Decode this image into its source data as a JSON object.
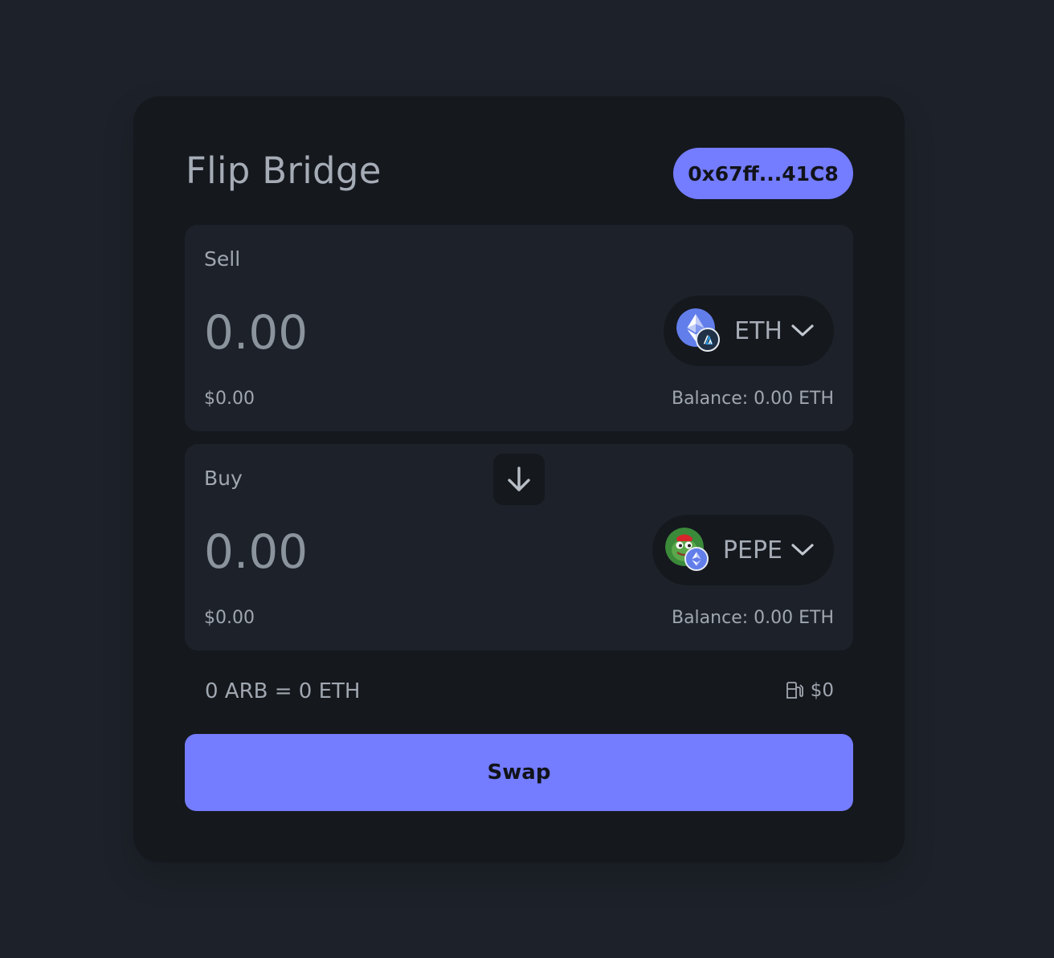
{
  "header": {
    "title": "Flip Bridge",
    "wallet_address": "0x67ff...41C8"
  },
  "sell": {
    "label": "Sell",
    "amount_placeholder": "0.00",
    "usd_value": "$0.00",
    "balance": "Balance: 0.00 ETH",
    "token": {
      "symbol": "ETH",
      "icon": "ethereum-icon",
      "chain_badge": "arbitrum-icon"
    }
  },
  "buy": {
    "label": "Buy",
    "amount_placeholder": "0.00",
    "usd_value": "$0.00",
    "balance": "Balance: 0.00 ETH",
    "token": {
      "symbol": "PEPE",
      "icon": "pepe-icon",
      "chain_badge": "ethereum-icon"
    }
  },
  "flip": {
    "icon": "arrow-down-icon"
  },
  "rate": "0 ARB = 0 ETH",
  "gas": {
    "icon": "gas-pump-icon",
    "value": "$0"
  },
  "swap_label": "Swap",
  "colors": {
    "accent": "#747cff",
    "background": "#1d222a",
    "card": "#15181d",
    "text_muted": "#a0a7b0"
  }
}
